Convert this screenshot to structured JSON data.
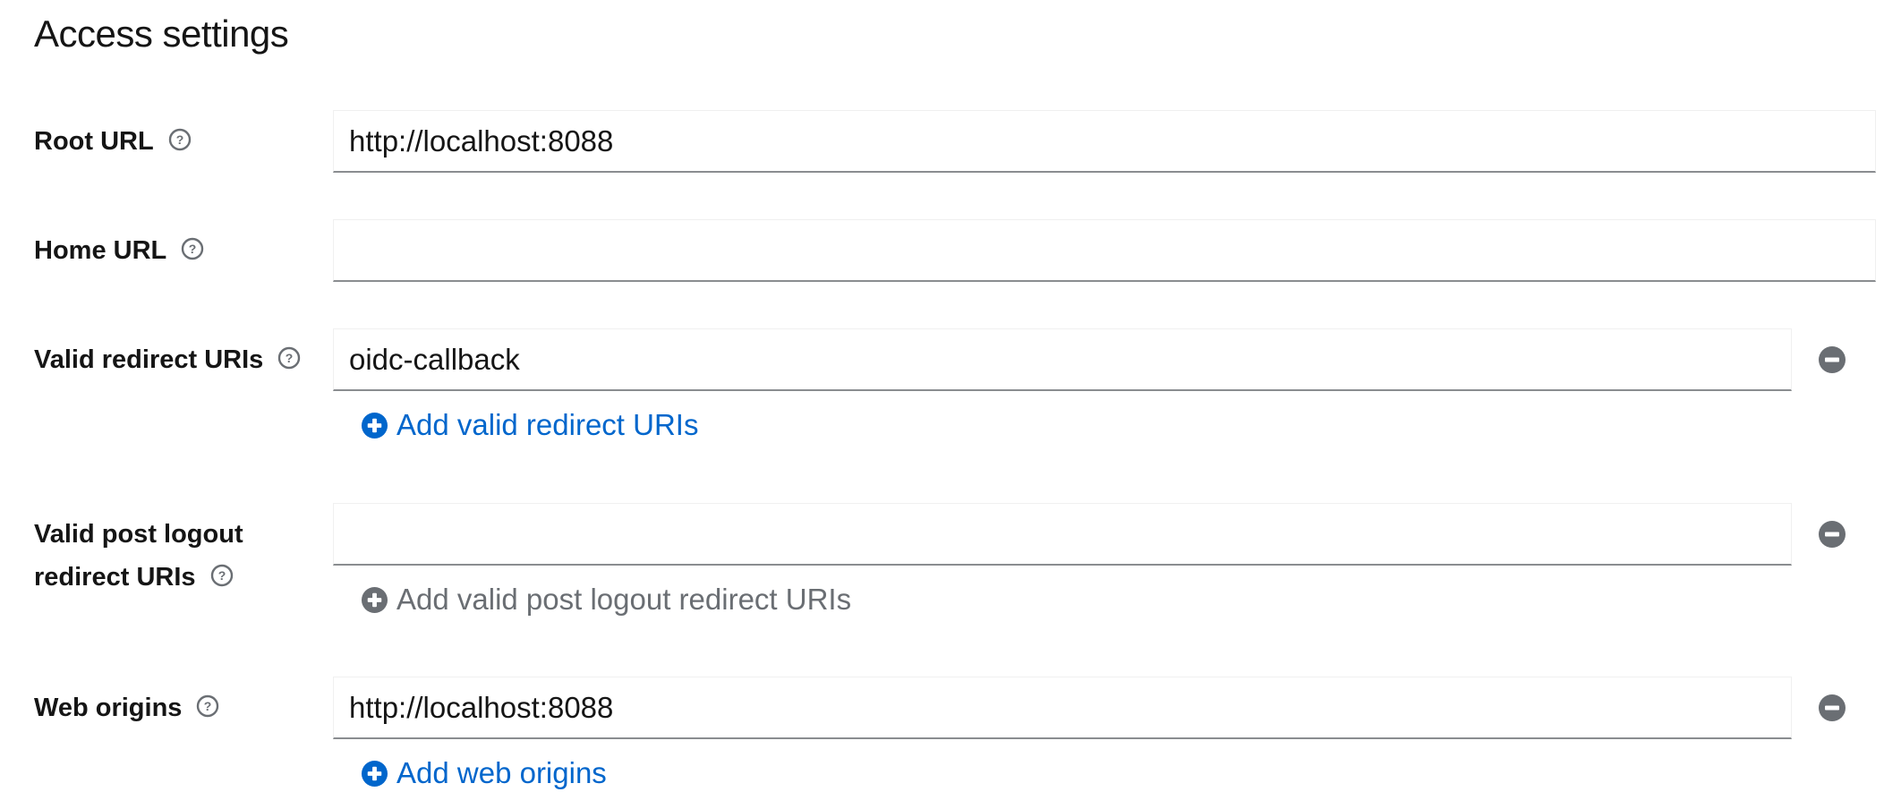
{
  "section": {
    "title": "Access settings"
  },
  "fields": {
    "root_url": {
      "label": "Root URL",
      "value": "http://localhost:8088"
    },
    "home_url": {
      "label": "Home URL",
      "value": ""
    },
    "valid_redirect_uris": {
      "label": "Valid redirect URIs",
      "value": "oidc-callback",
      "add_label": "Add valid redirect URIs"
    },
    "valid_post_logout": {
      "label_line1": "Valid post logout",
      "label_line2": "redirect URIs",
      "value": "",
      "add_label": "Add valid post logout redirect URIs"
    },
    "web_origins": {
      "label": "Web origins",
      "value": "http://localhost:8088",
      "add_label": "Add web origins"
    }
  },
  "colors": {
    "link": "#0066cc",
    "disabled": "#6a6e73",
    "input_border": "#8a8d90",
    "remove_icon": "#6a6e73"
  },
  "icons": {
    "help": "question-circle-icon",
    "add": "plus-circle-icon",
    "remove": "minus-circle-icon"
  }
}
